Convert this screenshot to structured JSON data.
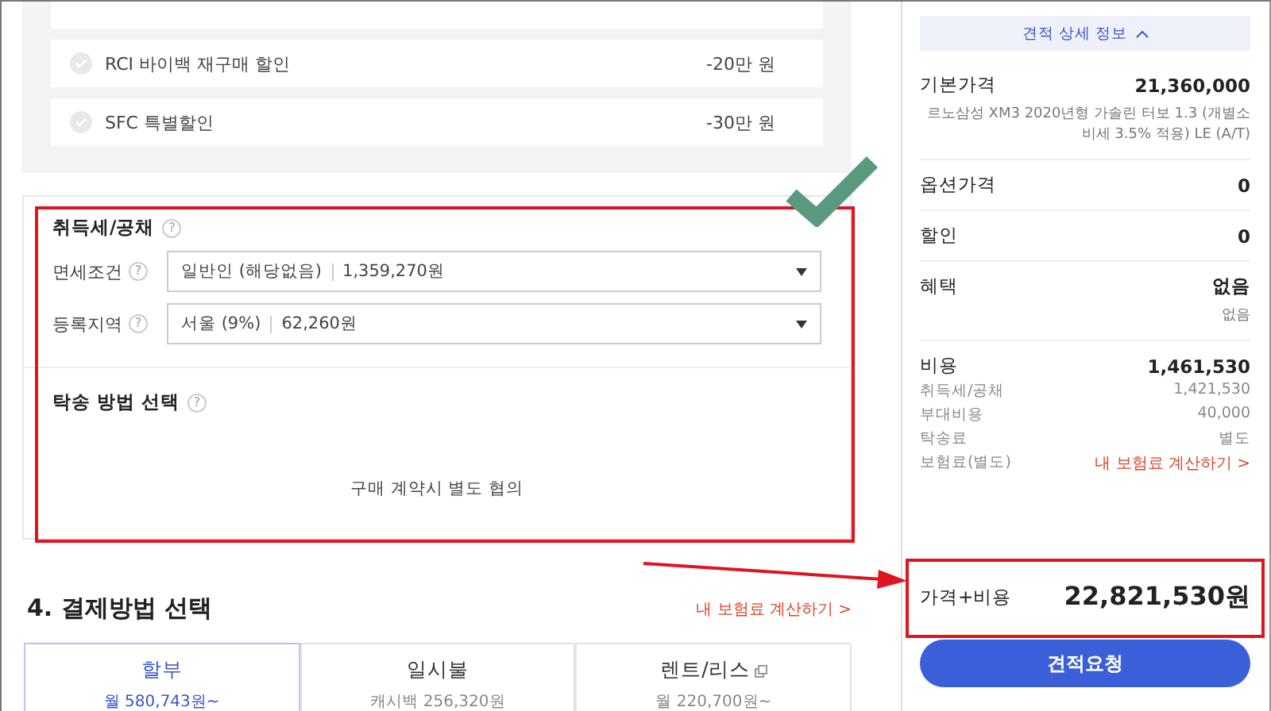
{
  "discounts": [
    {
      "label": "RCI 바이백 재구매 할인",
      "amount": "-20만 원"
    },
    {
      "label": "SFC 특별할인",
      "amount": "-30만 원"
    }
  ],
  "tax_section": {
    "title": "취득세/공채",
    "help": "?",
    "fields": [
      {
        "label": "면세조건",
        "help": "?",
        "value": "일반인 (해당없음)",
        "amount": "1,359,270원"
      },
      {
        "label": "등록지역",
        "help": "?",
        "value": "서울 (9%)",
        "amount": "62,260원"
      }
    ]
  },
  "delivery": {
    "title": "탁송 방법 선택",
    "help": "?",
    "note": "구매 계약시 별도 협의"
  },
  "payment": {
    "title": "4. 결제방법 선택",
    "link": "내 보험료 계산하기 >",
    "tabs": [
      {
        "label": "할부",
        "sub": "월 580,743원~",
        "selected": true,
        "popup_icon": false
      },
      {
        "label": "일시불",
        "sub": "캐시백 256,320원",
        "selected": false,
        "popup_icon": false
      },
      {
        "label": "렌트/리스",
        "sub": "월 220,700원~",
        "selected": false,
        "popup_icon": true
      }
    ]
  },
  "summary": {
    "toggle": "견적 상세 정보",
    "groups": [
      {
        "label": "기본가격",
        "value": "21,360,000",
        "note": "르노삼성 XM3 2020년형 가솔린 터보 1.3 (개별소비세 3.5% 적용) LE (A/T)"
      },
      {
        "label": "옵션가격",
        "value": "0"
      },
      {
        "label": "할인",
        "value": "0"
      },
      {
        "label": "혜택",
        "value": "없음",
        "note": "없음"
      },
      {
        "label": "비용",
        "value": "1,461,530",
        "details": [
          {
            "kind": "text",
            "label": "취득세/공채",
            "value": "1,421,530"
          },
          {
            "kind": "text",
            "label": "부대비용",
            "value": "40,000"
          },
          {
            "kind": "text",
            "label": "탁송료",
            "value": "별도"
          },
          {
            "kind": "link",
            "label": "보험료(별도)",
            "value": "내 보험료 계산하기 >"
          }
        ]
      }
    ]
  },
  "total": {
    "label": "가격+비용",
    "amount": "22,821,530원"
  },
  "request_button": "견적요청"
}
